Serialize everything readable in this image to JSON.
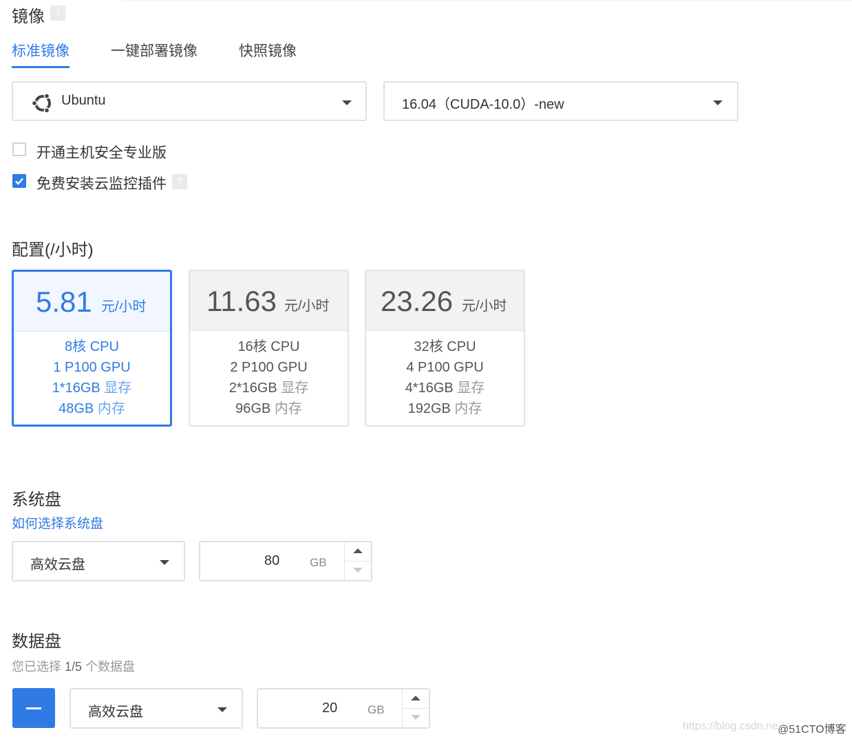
{
  "image_section": {
    "title": "镜像",
    "help_icon": "?",
    "tabs": [
      {
        "label": "标准镜像",
        "active": true
      },
      {
        "label": "一键部署镜像",
        "active": false
      },
      {
        "label": "快照镜像",
        "active": false
      }
    ],
    "os_select": {
      "value": "Ubuntu",
      "icon": "ubuntu-logo-icon"
    },
    "version_select": {
      "value": "16.04（CUDA-10.0）-new"
    },
    "options": [
      {
        "label": "开通主机安全专业版",
        "checked": false
      },
      {
        "label": "免费安装云监控插件",
        "checked": true,
        "help_icon": "?"
      }
    ]
  },
  "config_section": {
    "title": "配置(/小时)",
    "cards": [
      {
        "price": "5.81",
        "unit": "元/小时",
        "cpu_num": "8核",
        "cpu_txt": "CPU",
        "gpu_num": "1",
        "gpu_txt": "P100 GPU",
        "vram_num": "1*16GB",
        "vram_txt": "显存",
        "mem_num": "48GB",
        "mem_txt": "内存",
        "selected": true
      },
      {
        "price": "11.63",
        "unit": "元/小时",
        "cpu_num": "16核",
        "cpu_txt": "CPU",
        "gpu_num": "2",
        "gpu_txt": "P100 GPU",
        "vram_num": "2*16GB",
        "vram_txt": "显存",
        "mem_num": "96GB",
        "mem_txt": "内存",
        "selected": false
      },
      {
        "price": "23.26",
        "unit": "元/小时",
        "cpu_num": "32核",
        "cpu_txt": "CPU",
        "gpu_num": "4",
        "gpu_txt": "P100 GPU",
        "vram_num": "4*16GB",
        "vram_txt": "显存",
        "mem_num": "192GB",
        "mem_txt": "内存",
        "selected": false
      }
    ]
  },
  "system_disk": {
    "title": "系统盘",
    "help_link": "如何选择系统盘",
    "type_select": "高效云盘",
    "size": "80",
    "unit": "GB"
  },
  "data_disk": {
    "title": "数据盘",
    "count_prefix": "您已选择",
    "count_value": "1/5",
    "count_suffix": "个数据盘",
    "type_select": "高效云盘",
    "size": "20",
    "unit": "GB"
  },
  "watermark": {
    "left": "https://blog.csdn.ne",
    "right": "@51CTO博客"
  },
  "colors": {
    "accent": "#2f7ae5",
    "border": "#dfe1e5",
    "text": "#333333",
    "muted": "#999999"
  }
}
